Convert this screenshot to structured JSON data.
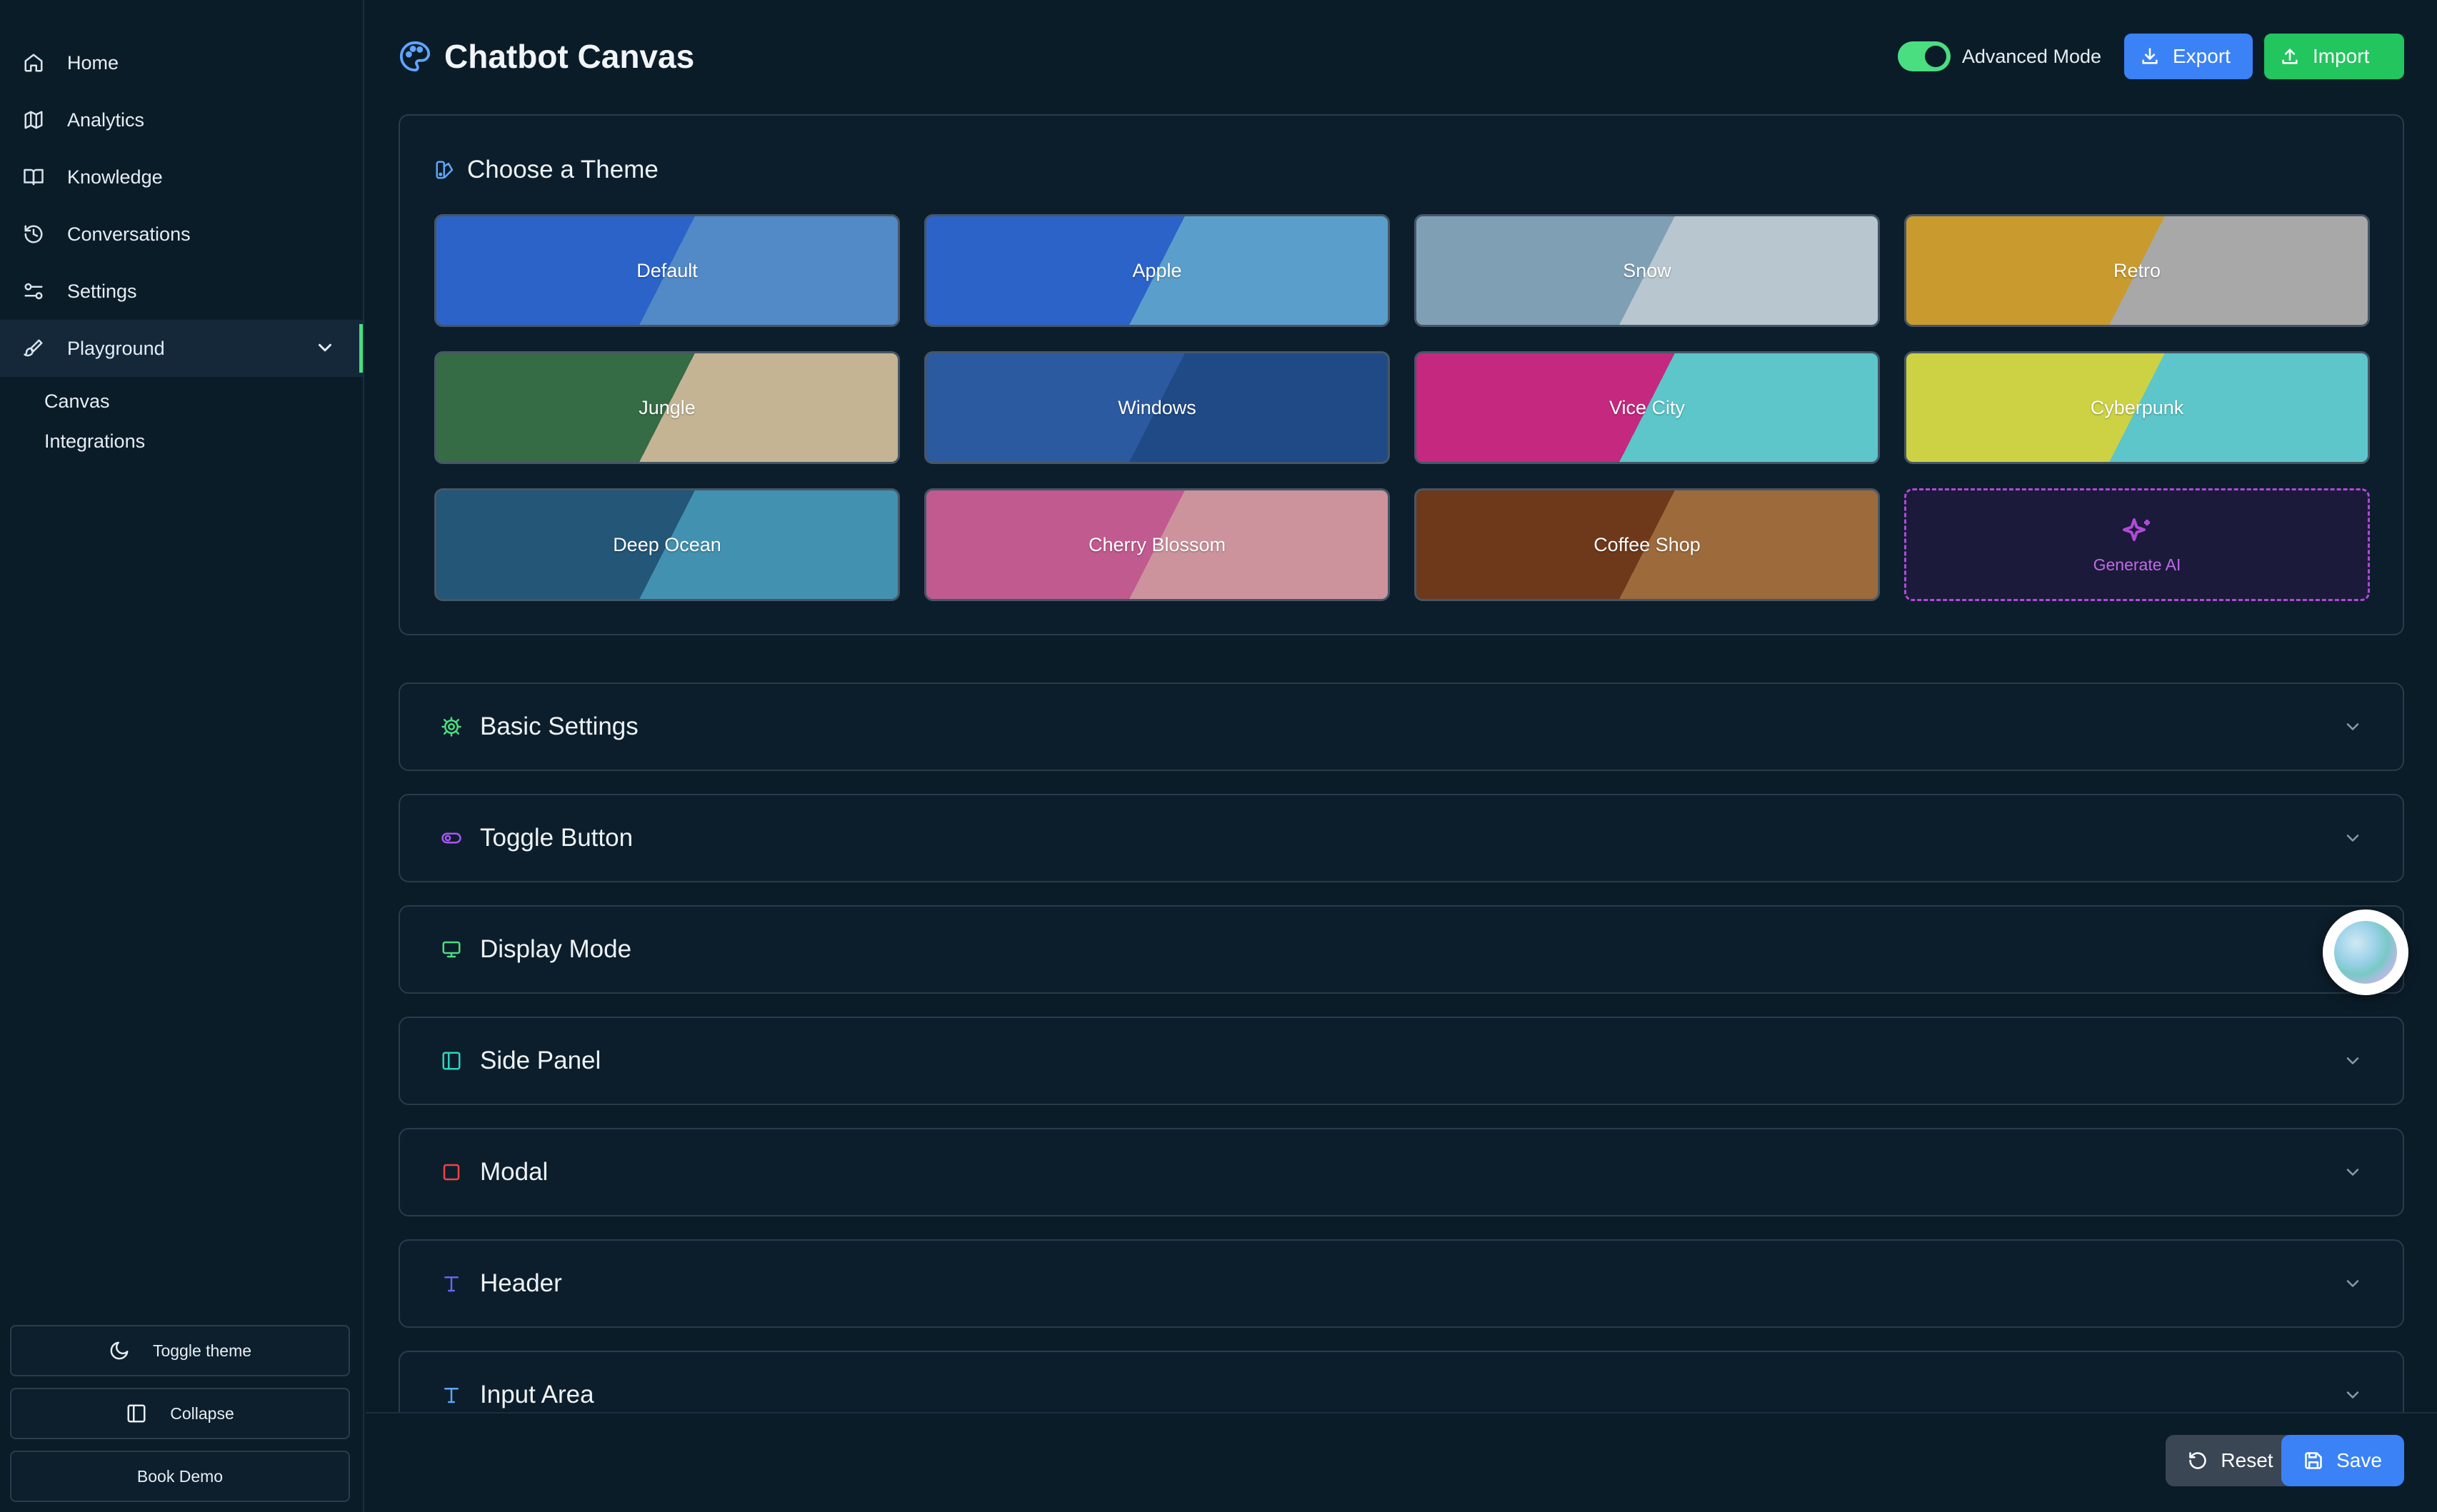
{
  "sidebar": {
    "items": [
      {
        "label": "Home",
        "icon": "home-icon"
      },
      {
        "label": "Analytics",
        "icon": "map-icon"
      },
      {
        "label": "Knowledge",
        "icon": "book-icon"
      },
      {
        "label": "Conversations",
        "icon": "history-icon"
      },
      {
        "label": "Settings",
        "icon": "sliders-icon"
      },
      {
        "label": "Playground",
        "icon": "brush-icon"
      }
    ],
    "subitems": [
      "Canvas",
      "Integrations"
    ],
    "bottom": {
      "toggle_theme": "Toggle theme",
      "collapse": "Collapse",
      "book_demo": "Book Demo"
    },
    "accent": "#4ade80"
  },
  "header": {
    "title": "Chatbot Canvas",
    "advanced_mode": "Advanced Mode",
    "advanced_mode_on": true,
    "export": "Export",
    "import": "Import"
  },
  "themes": {
    "title": "Choose a Theme",
    "items": [
      {
        "label": "Default",
        "c1": "#2b63c9",
        "c2": "#5289c7"
      },
      {
        "label": "Apple",
        "c1": "#2b63c9",
        "c2": "#5a9fcc"
      },
      {
        "label": "Snow",
        "c1": "#7f9fb5",
        "c2": "#b8c6cf"
      },
      {
        "label": "Retro",
        "c1": "#c99a2e",
        "c2": "#a8a8a8"
      },
      {
        "label": "Jungle",
        "c1": "#356b45",
        "c2": "#c4b494"
      },
      {
        "label": "Windows",
        "c1": "#2c5aa0",
        "c2": "#1f4a85"
      },
      {
        "label": "Vice City",
        "c1": "#c4297f",
        "c2": "#5cc6ca"
      },
      {
        "label": "Cyberpunk",
        "c1": "#cdd244",
        "c2": "#5cc6ca"
      },
      {
        "label": "Deep Ocean",
        "c1": "#235677",
        "c2": "#4291b0"
      },
      {
        "label": "Cherry Blossom",
        "c1": "#c05a8f",
        "c2": "#cc939d"
      },
      {
        "label": "Coffee Shop",
        "c1": "#6e381a",
        "c2": "#9d6a3c"
      }
    ],
    "generate": "Generate AI"
  },
  "sections": [
    {
      "label": "Basic Settings",
      "icon": "gear-icon",
      "color": "#4ade80"
    },
    {
      "label": "Toggle Button",
      "icon": "toggle-icon",
      "color": "#a855f7"
    },
    {
      "label": "Display Mode",
      "icon": "monitor-icon",
      "color": "#4ade80"
    },
    {
      "label": "Side Panel",
      "icon": "panel-left-icon",
      "color": "#2dd4bf"
    },
    {
      "label": "Modal",
      "icon": "square-icon",
      "color": "#ef4444"
    },
    {
      "label": "Header",
      "icon": "type-icon",
      "color": "#6366f1"
    },
    {
      "label": "Input Area",
      "icon": "type-icon",
      "color": "#60a5fa"
    }
  ],
  "footer": {
    "reset": "Reset",
    "save": "Save"
  }
}
